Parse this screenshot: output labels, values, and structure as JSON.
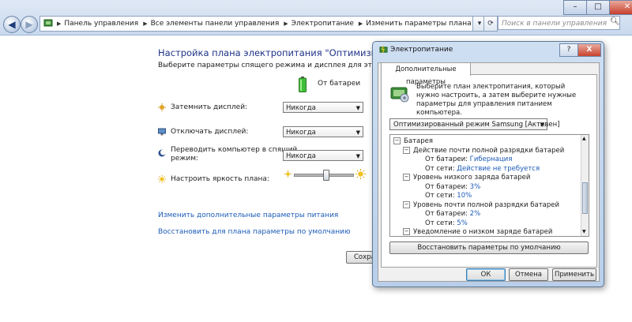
{
  "window": {
    "minimize_icon": "minimize-icon",
    "maximize_icon": "maximize-icon",
    "close_icon": "close-icon"
  },
  "nav": {
    "back_icon": "back-arrow-icon",
    "forward_icon": "forward-arrow-icon",
    "breadcrumb": [
      "Панель управления",
      "Все элементы панели управления",
      "Электропитание",
      "Изменить параметры плана"
    ],
    "search_placeholder": "Поиск в панели управления"
  },
  "main": {
    "title": "Настройка плана электропитания \"Оптимизированный",
    "subtitle": "Выберите параметры спящего режима и дисплея для этого компьютер",
    "column_header": "От батареи",
    "rows": [
      {
        "label": "Затемнить дисплей:",
        "value": "Никогда"
      },
      {
        "label": "Отключать дисплей:",
        "value": "Никогда"
      },
      {
        "label": "Переводить компьютер в спящий",
        "label2": "режим:",
        "value": "Никогда"
      }
    ],
    "brightness_label": "Настроить яркость плана:",
    "brightness_level": 0.55,
    "link_advanced": "Изменить дополнительные параметры питания",
    "link_restore": "Восстановить для плана параметры по умолчанию",
    "save_button_partial": "Сохра"
  },
  "dialog": {
    "title": "Электропитание",
    "help_label": "?",
    "close_label": "X",
    "tab_label": "Дополнительные параметры",
    "description": "Выберите план электропитания, который нужно настроить, а затем выберите нужные параметры для управления питанием компьютера.",
    "plan_selected": "Оптимизированный режим Samsung [Активен]",
    "tree": [
      {
        "text": "Батарея",
        "toggle": "−",
        "level": 0
      },
      {
        "text": "Действие почти полной разрядки батарей",
        "toggle": "−",
        "level": 1
      },
      {
        "key": "От батареи:",
        "val": "Гибернация",
        "level": 2
      },
      {
        "key": "От сети:",
        "val": "Действие не требуется",
        "level": 2
      },
      {
        "text": "Уровень низкого заряда батарей",
        "toggle": "−",
        "level": 1
      },
      {
        "key": "От батареи:",
        "val": "3%",
        "level": 2
      },
      {
        "key": "От сети:",
        "val": "10%",
        "level": 2
      },
      {
        "text": "Уровень почти полной разрядки батарей",
        "toggle": "−",
        "level": 1
      },
      {
        "key": "От батареи:",
        "val": "2%",
        "level": 2
      },
      {
        "key": "От сети:",
        "val": "5%",
        "level": 2
      },
      {
        "text": "Уведомление о низком заряде батарей",
        "toggle": "−",
        "level": 1
      }
    ],
    "restore_button": "Восстановить параметры по умолчанию",
    "ok_button": "ОК",
    "cancel_button": "Отмена",
    "apply_button": "Применить"
  }
}
